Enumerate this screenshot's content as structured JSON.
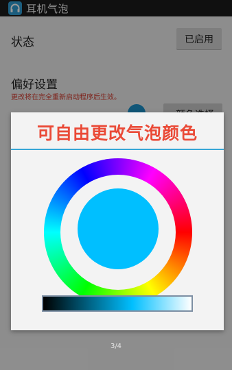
{
  "titlebar": {
    "title": "耳机气泡",
    "icon": "headphones-icon"
  },
  "settings": {
    "status_label": "状态",
    "status_button": "已启用",
    "preferences_title": "偏好设置",
    "preferences_note": "更改将在完全重新启动程序后生效。",
    "partial_button_label": "颜色选择器"
  },
  "dialog": {
    "title": "可自由更改气泡颜色",
    "selected_color": "#00BFFF",
    "accent_color": "#36A6D6",
    "title_color": "#EA4A37"
  },
  "pager": {
    "text": "3/4"
  }
}
